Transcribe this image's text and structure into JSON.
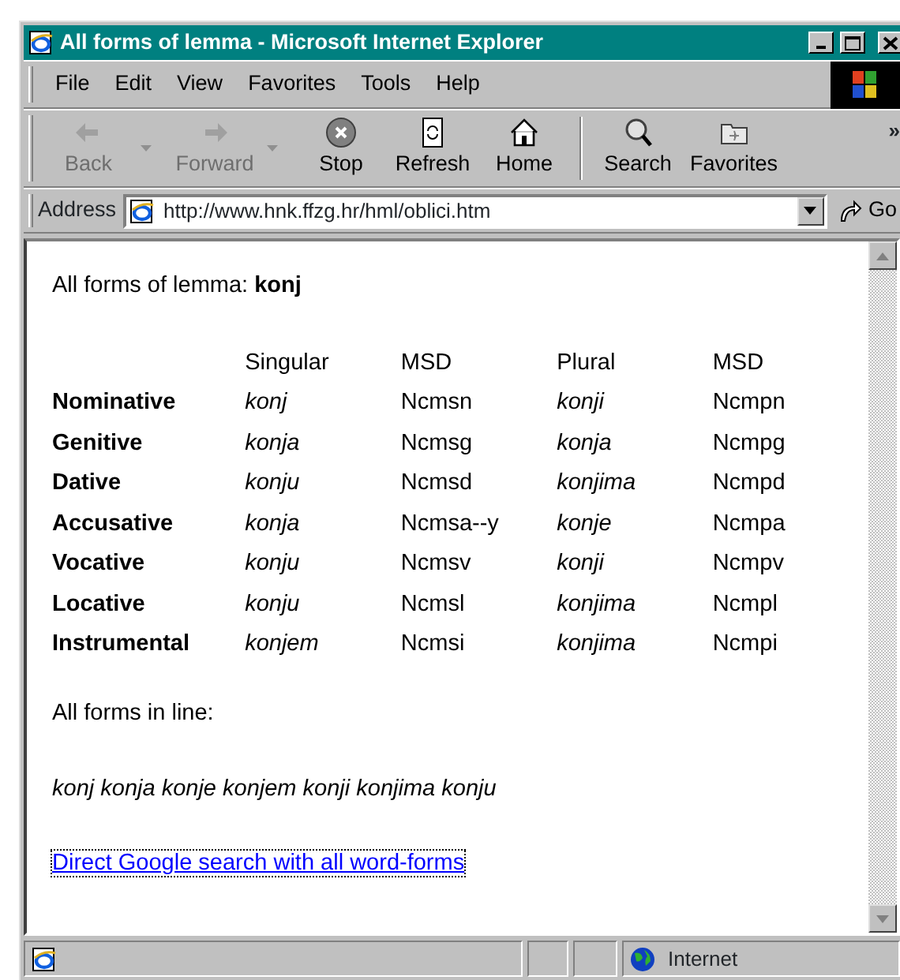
{
  "window": {
    "title": "All forms of lemma - Microsoft Internet Explorer"
  },
  "menu": [
    {
      "label": "File"
    },
    {
      "label": "Edit"
    },
    {
      "label": "View"
    },
    {
      "label": "Favorites"
    },
    {
      "label": "Tools"
    },
    {
      "label": "Help"
    }
  ],
  "toolbar": {
    "groups": [
      [
        {
          "label": "Back",
          "kind": "back",
          "disabled": true,
          "dropdown": true
        },
        {
          "label": "Forward",
          "kind": "forward",
          "disabled": true,
          "dropdown": true
        },
        {
          "label": "Stop",
          "kind": "stop",
          "disabled": false,
          "dropdown": false
        },
        {
          "label": "Refresh",
          "kind": "refresh",
          "disabled": false,
          "dropdown": false
        },
        {
          "label": "Home",
          "kind": "home",
          "disabled": false,
          "dropdown": false
        }
      ],
      [
        {
          "label": "Search",
          "kind": "search",
          "disabled": false,
          "dropdown": false
        },
        {
          "label": "Favorites",
          "kind": "favorites",
          "disabled": false,
          "dropdown": false
        }
      ]
    ],
    "overflow": "»"
  },
  "address": {
    "label": "Address",
    "value": "http://www.hnk.ffzg.hr/hml/oblici.htm",
    "go": "Go"
  },
  "page": {
    "heading": "All forms of lemma: **konj**",
    "columns": [
      {
        "label": "Singular",
        "kind": "form"
      },
      {
        "label": "MSD",
        "kind": "msd"
      },
      {
        "label": "Plural",
        "kind": "form"
      },
      {
        "label": "MSD",
        "kind": "msd"
      }
    ],
    "rows": [
      {
        "case": "Nominative",
        "cells": [
          "konj",
          "Ncmsn",
          "konji",
          "Ncmpn"
        ]
      },
      {
        "case": "Genitive",
        "cells": [
          "konja",
          "Ncmsg",
          "konja",
          "Ncmpg"
        ]
      },
      {
        "case": "Dative",
        "cells": [
          "konju",
          "Ncmsd",
          "konjima",
          "Ncmpd"
        ]
      },
      {
        "case": "Accusative",
        "cells": [
          "konja",
          "Ncmsa--y",
          "konje",
          "Ncmpa"
        ]
      },
      {
        "case": "Vocative",
        "cells": [
          "konju",
          "Ncmsv",
          "konji",
          "Ncmpv"
        ]
      },
      {
        "case": "Locative",
        "cells": [
          "konju",
          "Ncmsl",
          "konjima",
          "Ncmpl"
        ]
      },
      {
        "case": "Instrumental",
        "cells": [
          "konjem",
          "Ncmsi",
          "konjima",
          "Ncmpi"
        ]
      }
    ],
    "in_line_label": "All forms in line:",
    "in_line": "konj konja konje konjem konji konjima konju",
    "link": {
      "label": "Direct Google search with all word-forms",
      "focused": true
    }
  },
  "status_bar": {
    "zone": "Internet"
  }
}
